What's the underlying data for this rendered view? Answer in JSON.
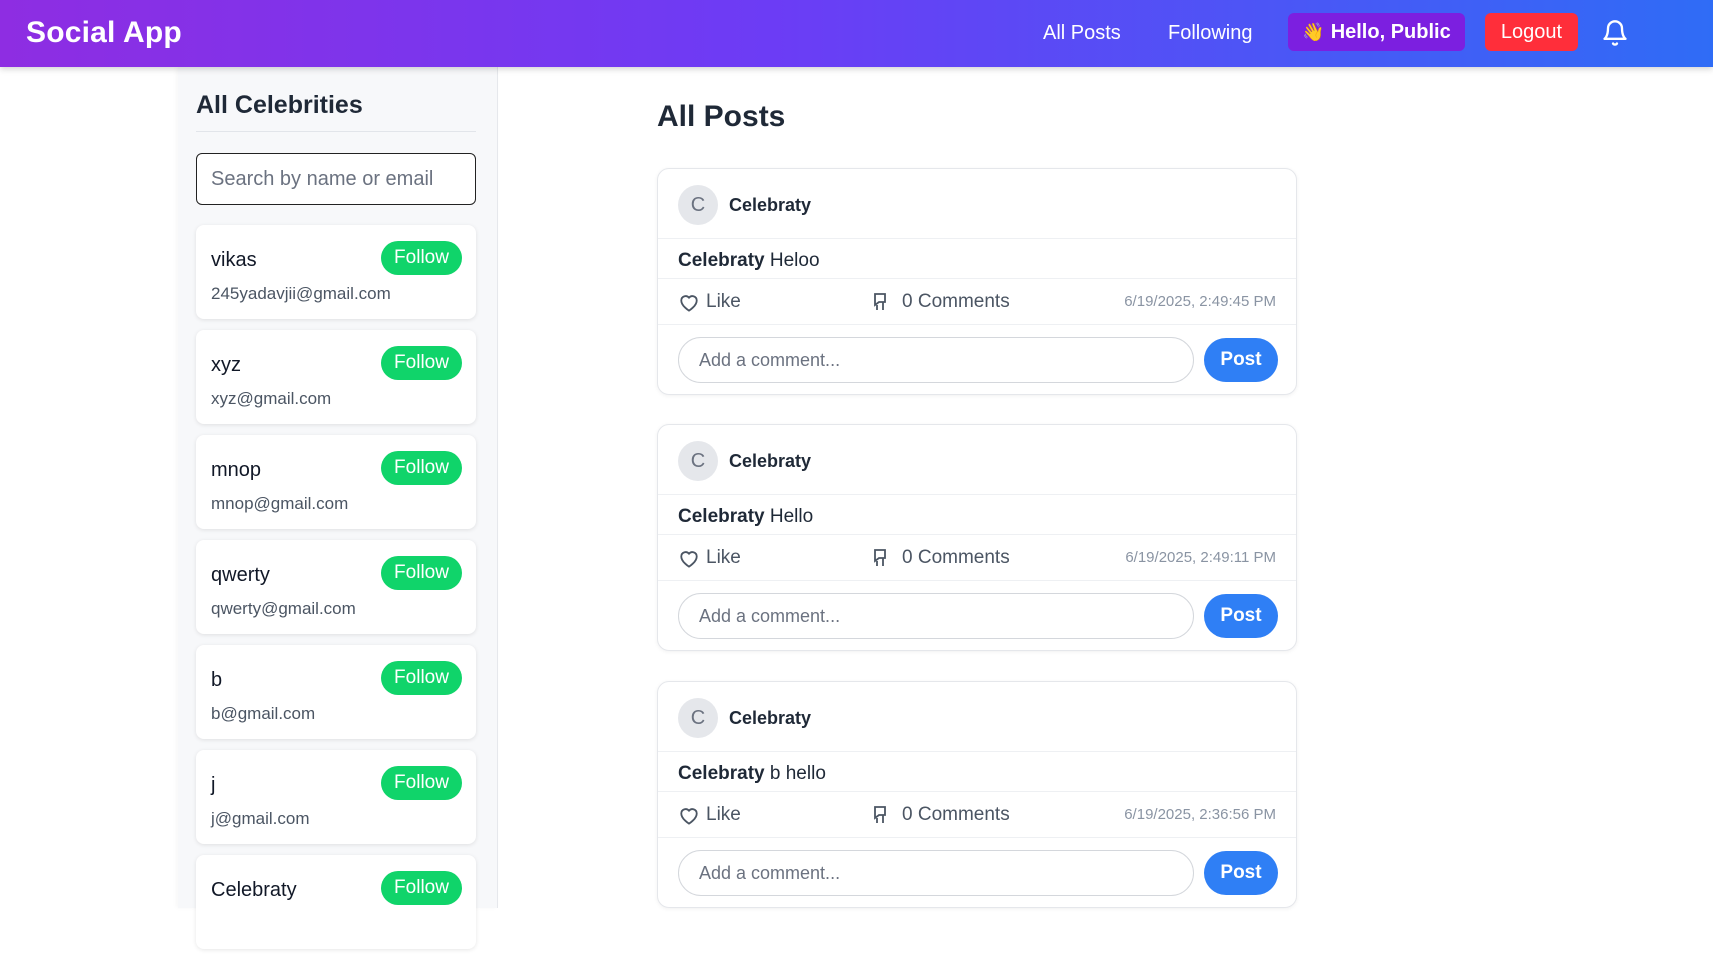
{
  "navbar": {
    "brand": "Social App",
    "links": [
      "All Posts",
      "Following"
    ],
    "greeting": "Hello, Public",
    "greeting_icon": "waving-hand-icon",
    "logout_label": "Logout",
    "notifications_icon": "bell-icon"
  },
  "sidebar": {
    "title": "All Celebrities",
    "search_placeholder": "Search by name or email",
    "follow_label": "Follow",
    "celebrities": [
      {
        "name": "vikas",
        "email": "245yadavjii@gmail.com"
      },
      {
        "name": "xyz",
        "email": "xyz@gmail.com"
      },
      {
        "name": "mnop",
        "email": "mnop@gmail.com"
      },
      {
        "name": "qwerty",
        "email": "qwerty@gmail.com"
      },
      {
        "name": "b",
        "email": "b@gmail.com"
      },
      {
        "name": "j",
        "email": "j@gmail.com"
      },
      {
        "name": "Celebraty",
        "email": ""
      }
    ]
  },
  "main": {
    "title": "All Posts",
    "like_label": "Like",
    "comment_placeholder": "Add a comment...",
    "post_button_label": "Post",
    "posts": [
      {
        "avatar_letter": "C",
        "author": "Celebraty",
        "body_author": "Celebraty",
        "body_text": "Heloo",
        "comments_label": "0 Comments",
        "timestamp": "6/19/2025, 2:49:45 PM"
      },
      {
        "avatar_letter": "C",
        "author": "Celebraty",
        "body_author": "Celebraty",
        "body_text": "Hello",
        "comments_label": "0 Comments",
        "timestamp": "6/19/2025, 2:49:11 PM"
      },
      {
        "avatar_letter": "C",
        "author": "Celebraty",
        "body_author": "Celebraty",
        "body_text": "b hello",
        "comments_label": "0 Comments",
        "timestamp": "6/19/2025, 2:36:56 PM"
      }
    ]
  },
  "colors": {
    "navbar_gradient_start": "#8e2de2",
    "navbar_gradient_end": "#2f6cf6",
    "follow_green": "#10d46a",
    "logout_red": "#ff2e3a",
    "post_blue": "#2f7ff5",
    "greeting_purple": "#7c1fe0"
  }
}
